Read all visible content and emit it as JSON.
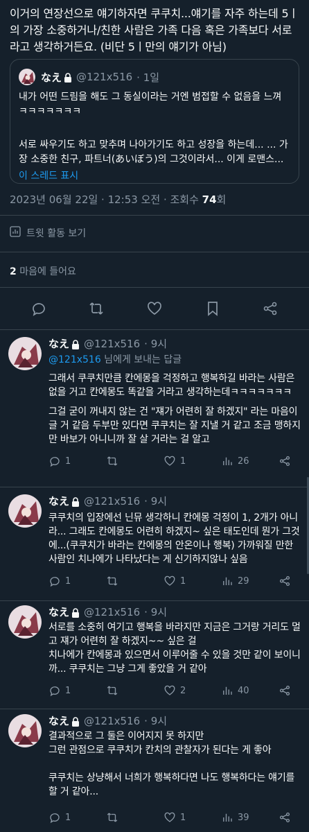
{
  "main_tweet": {
    "text": "이거의 연장선으로 얘기하자면 쿠쿠치...얘기를 자주 하는데 5ㅣ의 가장 소중하거나/친한 사람은 가족 다음 혹은 가족보다 서로라고 생각하거든요. (비단 5ㅣ만의 얘기가 아님)"
  },
  "quote": {
    "name": "なえ",
    "handle": "@121x516",
    "time": "· 1일",
    "line1": "내가 어떤 드림을 해도 그 동실이라는 거엔 범접할 수 없음을 느껴ㅋㅋㅋㅋㅋㅋㅋ",
    "line2": "서로 싸우기도 하고 맞추며 나아가기도 하고 성장을 하는데... ... 가장 소중한 친구, 파트너(あいぼう)의 그것이라서... 이게 로맨스...",
    "show_thread": "이 스레드 표시"
  },
  "meta": {
    "timestamp": "2023년 06월 22일 · 12:53 오전 · 조회수 ",
    "views": "74",
    "views_unit": "회",
    "activity": "트윗 활동 보기",
    "likes_count": "2",
    "likes_label": "마음에 들어요"
  },
  "replies": [
    {
      "name": "なえ",
      "handle": "@121x516",
      "time": "· 9시",
      "reply_to_mention": "@121x516",
      "reply_to_suffix": " 님에게 보내는 답글",
      "body1": "그래서 쿠쿠치만큼 칸에몽을 걱정하고 행복하길 바라는 사람은 없을 거고 칸에몽도 똑같을 거라고 생각하는데ㅋㅋㅋㅋㅋㅋㅋ",
      "body2": "그걸 굳이 꺼내지 않는 건 \"쟤가 어련히 잘 하겠지\" 라는 마음이 글 거 같음 두부만 있다면 쿠쿠치는 잘 지낼 거 같고 조금 맹하지만 바보가 아니니까 잘 살 거라는 걸 알고",
      "replies": "1",
      "retweets": "",
      "likes": "1",
      "views": "26"
    },
    {
      "name": "なえ",
      "handle": "@121x516",
      "time": "· 9시",
      "body1": "쿠쿠치의 입장에선 닌뮤 생각하니 칸에몽 걱정이 1, 2개가 아니라... 그래도 칸에몽도 어련히 하겠지~ 싶은 태도인데 뭔가 그것에...(쿠쿠치가 바라는 칸에몽의 안온이나 행복) 가까워질 만한 사람인 치나에가 나타났다는 게 신기하지않나 싶음",
      "replies": "1",
      "retweets": "",
      "likes": "1",
      "views": "29"
    },
    {
      "name": "なえ",
      "handle": "@121x516",
      "time": "· 9시",
      "body1": "서로를 소중히 여기고 행복을 바라지만 지금은 그거랑 거리도 멀고 쟤가 어련히 잘 하겠지~~ 싶은 걸",
      "body2": "치나에가 칸에몽과 있으면서 이루어줄 수 있을 것만 같이 보이니까... 쿠쿠치는 그냥 그게 좋았을 거 같아",
      "replies": "1",
      "retweets": "",
      "likes": "2",
      "views": "40"
    },
    {
      "name": "なえ",
      "handle": "@121x516",
      "time": "· 9시",
      "body1": "결과적으로 그 둘은 이어지지 못 하지만",
      "body1b": "그런 관점으로 쿠쿠치가 칸치의 관찰자가 된다는 게 좋아",
      "body2": "쿠쿠치는 상냥해서 너희가 행복하다면 나도 행복하다는 얘기를 할 거 같아...",
      "replies": "1",
      "retweets": "",
      "likes": "1",
      "views": "39"
    }
  ],
  "colors": {
    "background": "#15202b",
    "accent": "#1d9bf0",
    "muted": "#8b98a5",
    "divider": "#38444d"
  }
}
